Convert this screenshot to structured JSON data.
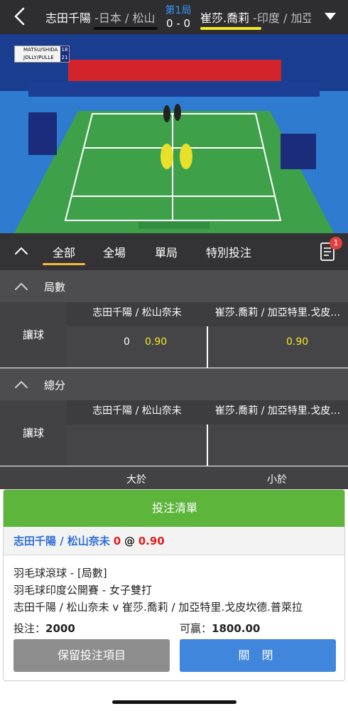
{
  "header": {
    "home_name": "志田千陽",
    "home_country": " -日本 / 松山",
    "away_name": "崔莎.喬莉",
    "away_country": " -印度 / 加亞",
    "round": "第1局",
    "score": "0 - 0"
  },
  "video": {
    "mini_score": [
      {
        "team": "MATSU/SHIDA",
        "points": "18"
      },
      {
        "team": "JOLLY/PULLE",
        "points": "21"
      }
    ]
  },
  "tabs": {
    "items": [
      "全部",
      "全場",
      "單局",
      "特別投注"
    ],
    "active": "全部",
    "badge": "1"
  },
  "markets": {
    "games": {
      "title": "局數",
      "label": "讓球",
      "home_header": "志田千陽 / 松山奈未",
      "away_header": "崔莎.喬莉 / 加亞特里.戈皮…",
      "home_line": "0",
      "home_odds": "0.90",
      "away_odds": "0.90"
    },
    "total": {
      "title": "總分",
      "label": "讓球",
      "home_header": "志田千陽 / 松山奈未",
      "away_header": "崔莎.喬莉 / 加亞特里.戈皮…",
      "over_label": "大於",
      "under_label": "小於"
    }
  },
  "bet_slip": {
    "title": "投注清單",
    "selection_team": "志田千陽 / 松山奈未",
    "selection_line": "0",
    "selection_at": "@",
    "selection_odds": "0.90",
    "market": "羽毛球滾球 - [局數]",
    "league": "羽毛球印度公開賽 - 女子雙打",
    "matchup": "志田千陽 / 松山奈未 v 崔莎.喬莉 / 加亞特里.戈皮坎德.普萊拉",
    "stake_label": "投注：",
    "stake_value": "2000",
    "win_label": "可贏：",
    "win_value": "1800.00",
    "keep_button": "保留投注項目",
    "close_button": "關 閉"
  },
  "colors": {
    "header_bg": "#2e2e30",
    "active_tab": "#f6b93b",
    "odds": "#f2e829",
    "slip_header": "#5db53c",
    "close_button": "#3f86dc"
  }
}
